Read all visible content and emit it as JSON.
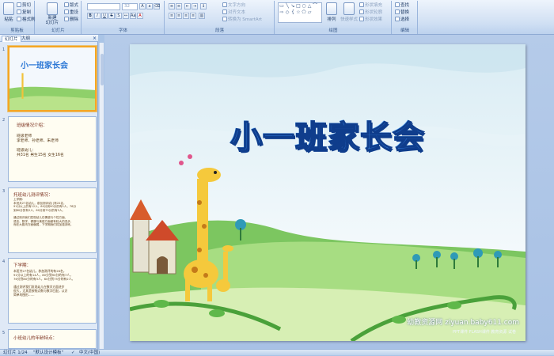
{
  "ribbon": {
    "clipboard": {
      "paste": "粘贴",
      "cut": "剪切",
      "copy": "复制",
      "painter": "格式刷",
      "label": "剪贴板"
    },
    "slides": {
      "new_slide": "新建\n幻灯片",
      "layout": "版式",
      "reset": "重设",
      "delete": "删除",
      "label": "幻灯片"
    },
    "font": {
      "font_size": "32",
      "label": "字体"
    },
    "paragraph": {
      "text_direction": "文字方向",
      "align_text": "对齐文本",
      "smartart": "转换为 SmartArt",
      "label": "段落"
    },
    "drawing": {
      "arrange": "排列",
      "quick_styles": "快速样式",
      "shape_fill": "形状填充",
      "shape_outline": "形状轮廓",
      "shape_effects": "形状效果",
      "label": "绘图"
    },
    "editing": {
      "find": "查找",
      "replace": "替换",
      "select": "选择",
      "label": "编辑"
    }
  },
  "pane": {
    "tab_slides": "幻灯片",
    "tab_outline": "大纲",
    "close": "×",
    "thumbs": [
      {
        "num": "1",
        "title": "小一班家长会"
      },
      {
        "num": "2",
        "title": "班级情况介绍：",
        "body": "班级老师\n  李老师、孙老师、朱老师\n\n班级幼儿：\n  共31名  男生15名  女生16名"
      },
      {
        "num": "3",
        "title": "托班幼儿测评情况：",
        "body": "上学期：\n  本班共27名幼儿，参加测评幼儿有22名，\n91分以上的有12人，80分到90分的有5人，76分\n到80分的有2人，60分到75分的有3人。\n\n  通过测评我们发现幼儿在情感与个性方面、\n语言、数学、健康与美感方面都有较大的进步，\n而在大肌肉方面偏弱，下学期我们将加强训练。"
      },
      {
        "num": "4",
        "title": "下学期：",
        "body": "  本班共27名幼儿，参加测评的有26名，\n91分以上的有14人，80分到90分的有7人，\n76分到80分的有3人，60分到75分的有2人。\n\n  通过测评我们发现幼儿在数学方面进步\n很大，尤其是按物点数与数字匹配，认识\n简单的图形……"
      },
      {
        "num": "5",
        "title": "小班幼儿的年龄特点："
      }
    ]
  },
  "slide": {
    "title": "小一班家长会",
    "watermark": "幼教资源网 ziyuan.baby611.com",
    "watermark_sub": "PPT课件  FLASH课件  教育资源  试卷"
  },
  "status": {
    "slide_counter": "幻灯片 1/24",
    "theme": "\"默认设计模板\"",
    "language": "中文(中国)"
  },
  "colors": {
    "title_fill": "#2e79d6",
    "title_stroke": "#0f3d8c",
    "selection": "#f5a623"
  }
}
